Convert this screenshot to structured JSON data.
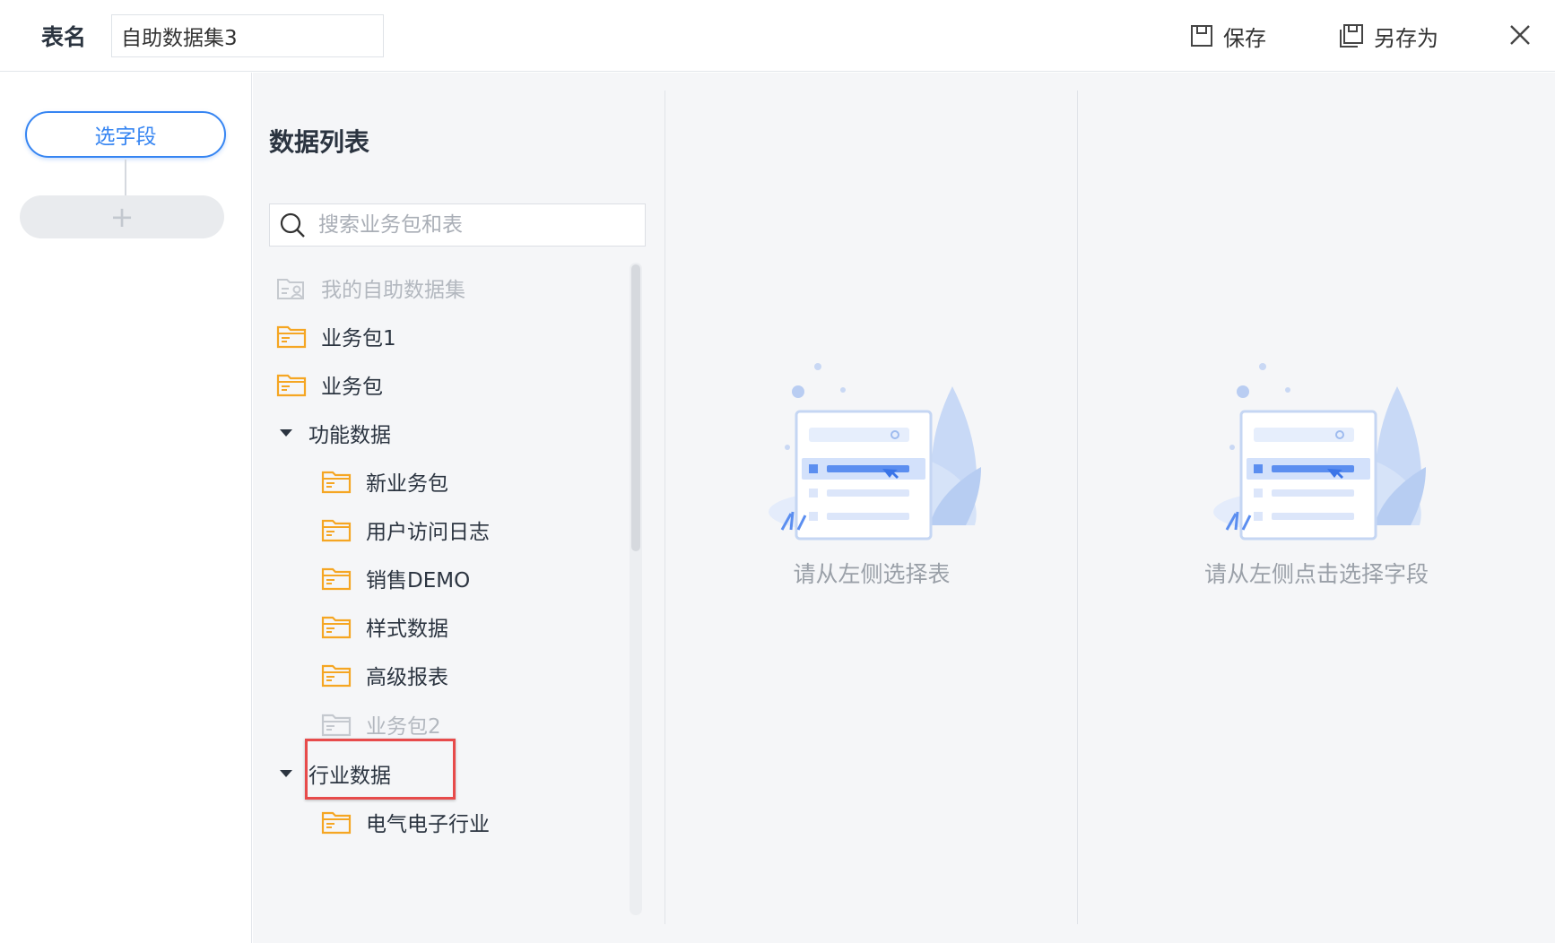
{
  "header": {
    "table_name_label": "表名",
    "table_name_value": "自助数据集3",
    "save_label": "保存",
    "save_as_label": "另存为"
  },
  "steps": {
    "active_step": "选字段",
    "add_symbol": "+"
  },
  "data_list": {
    "title": "数据列表",
    "search_placeholder": "搜索业务包和表",
    "items": [
      {
        "label": "我的自助数据集",
        "type": "self-dataset",
        "state": "disabled"
      },
      {
        "label": "业务包1",
        "type": "folder"
      },
      {
        "label": "业务包",
        "type": "folder"
      },
      {
        "label": "功能数据",
        "type": "group",
        "expanded": true
      },
      {
        "label": "新业务包",
        "type": "folder"
      },
      {
        "label": "用户访问日志",
        "type": "folder"
      },
      {
        "label": "销售DEMO",
        "type": "folder"
      },
      {
        "label": "样式数据",
        "type": "folder"
      },
      {
        "label": "高级报表",
        "type": "folder"
      },
      {
        "label": "业务包2",
        "type": "folder",
        "state": "disabled",
        "highlighted": true
      },
      {
        "label": "行业数据",
        "type": "group",
        "expanded": true
      },
      {
        "label": "电气电子行业",
        "type": "folder"
      }
    ]
  },
  "table_panel": {
    "empty_message": "请从左侧选择表"
  },
  "field_panel": {
    "empty_message": "请从左侧点击选择字段"
  },
  "colors": {
    "accent": "#3685f2",
    "folder": "#f5a623",
    "highlight": "#e74b4b",
    "disabled": "#b3b8bf"
  }
}
